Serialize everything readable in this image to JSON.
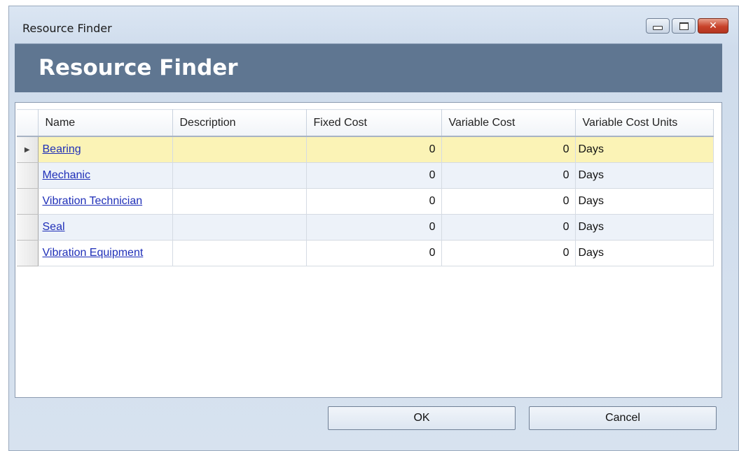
{
  "window": {
    "title": "Resource Finder"
  },
  "banner": {
    "title": "Resource Finder"
  },
  "grid": {
    "columns": [
      "Name",
      "Description",
      "Fixed Cost",
      "Variable Cost",
      "Variable Cost Units"
    ],
    "rows": [
      {
        "name": "Bearing",
        "description": "",
        "fixed_cost": "0",
        "variable_cost": "0",
        "units": "Days"
      },
      {
        "name": "Mechanic",
        "description": "",
        "fixed_cost": "0",
        "variable_cost": "0",
        "units": "Days"
      },
      {
        "name": "Vibration Technician",
        "description": "",
        "fixed_cost": "0",
        "variable_cost": "0",
        "units": "Days"
      },
      {
        "name": "Seal",
        "description": "",
        "fixed_cost": "0",
        "variable_cost": "0",
        "units": "Days"
      },
      {
        "name": "Vibration Equipment",
        "description": "",
        "fixed_cost": "0",
        "variable_cost": "0",
        "units": "Days"
      }
    ]
  },
  "buttons": {
    "ok": "OK",
    "cancel": "Cancel"
  },
  "colors": {
    "banner": "#5f7691",
    "active_row": "#fbf3b6",
    "alt_row": "#edf2f9",
    "link": "#1f2fb8"
  },
  "icons": {
    "current_row": "row-pointer-icon"
  }
}
